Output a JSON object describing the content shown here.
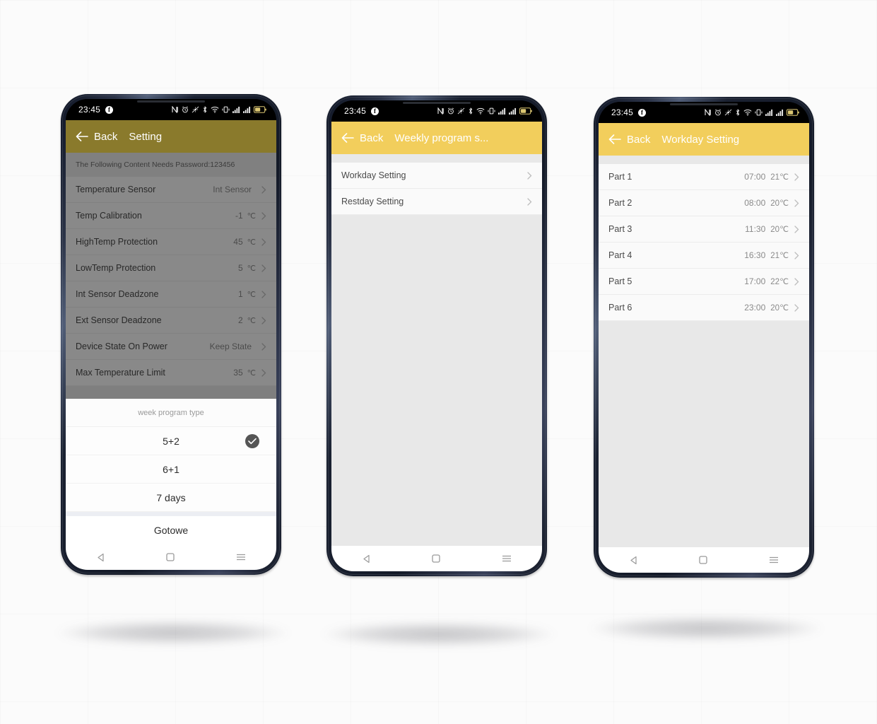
{
  "background": {
    "color": "#fbfbfb"
  },
  "theme": {
    "accent": "#f2ce5c",
    "accent_dimmed": "#8a7a2c",
    "body_bg": "#e8e8e8",
    "list_bg": "#fafafa",
    "check_circle": "#555555"
  },
  "status_bar": {
    "clock": "23:45",
    "fb_glyph": "f",
    "icons": [
      "nfc-icon",
      "alarm-icon",
      "location-off-icon",
      "bluetooth-icon",
      "wifi-icon",
      "vibrate-icon",
      "signal-1-icon",
      "signal-2-icon",
      "battery-icon"
    ]
  },
  "nav_bar": {
    "icons": [
      "nav-back-icon",
      "nav-home-icon",
      "nav-recents-icon"
    ]
  },
  "phones": [
    {
      "id": "phone-settings",
      "dimmed": true,
      "header": {
        "back_label": "Back",
        "title": "Setting"
      },
      "notice": "The Following Content Needs Password:123456",
      "rows": [
        {
          "label": "Temperature Sensor",
          "value": "Int Sensor",
          "unit": ""
        },
        {
          "label": "Temp Calibration",
          "value": "-1",
          "unit": "℃"
        },
        {
          "label": "HighTemp Protection",
          "value": "45",
          "unit": "℃"
        },
        {
          "label": "LowTemp Protection",
          "value": "5",
          "unit": "℃"
        },
        {
          "label": "Int Sensor Deadzone",
          "value": "1",
          "unit": "℃"
        },
        {
          "label": "Ext Sensor Deadzone",
          "value": "2",
          "unit": "℃"
        },
        {
          "label": "Device State On Power",
          "value": "Keep State",
          "unit": ""
        },
        {
          "label": "Max Temperature Limit",
          "value": "35",
          "unit": "℃"
        }
      ],
      "sheet": {
        "title": "week program type",
        "options": [
          {
            "label": "5+2",
            "selected": true
          },
          {
            "label": "6+1",
            "selected": false
          },
          {
            "label": "7 days",
            "selected": false
          }
        ],
        "done_label": "Gotowe"
      }
    },
    {
      "id": "phone-weekly-program",
      "dimmed": false,
      "header": {
        "back_label": "Back",
        "title": "Weekly program s..."
      },
      "rows": [
        {
          "label": "Workday Setting",
          "value": "",
          "unit": ""
        },
        {
          "label": "Restday Setting",
          "value": "",
          "unit": ""
        }
      ]
    },
    {
      "id": "phone-workday-setting",
      "dimmed": false,
      "header": {
        "back_label": "Back",
        "title": "Workday Setting"
      },
      "rows": [
        {
          "label": "Part 1",
          "time": "07:00",
          "temp": "21℃"
        },
        {
          "label": "Part 2",
          "time": "08:00",
          "temp": "20℃"
        },
        {
          "label": "Part 3",
          "time": "11:30",
          "temp": "20℃"
        },
        {
          "label": "Part 4",
          "time": "16:30",
          "temp": "21℃"
        },
        {
          "label": "Part 5",
          "time": "17:00",
          "temp": "22℃"
        },
        {
          "label": "Part 6",
          "time": "23:00",
          "temp": "20℃"
        }
      ]
    }
  ]
}
